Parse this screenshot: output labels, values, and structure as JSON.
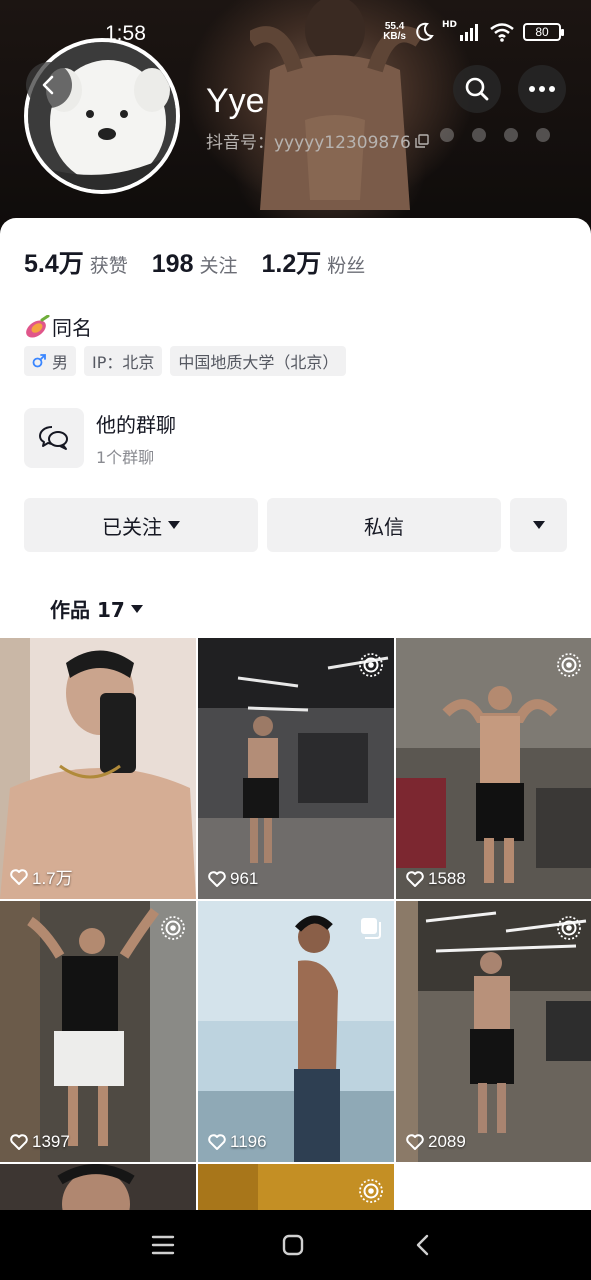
{
  "status_bar": {
    "time": "1:58",
    "net_speed_value": "55.4",
    "net_speed_unit": "KB/s",
    "hd_label": "HD",
    "battery": "80"
  },
  "profile": {
    "nickname": "Yye",
    "douyin_id": "抖音号：yyyyy12309876",
    "icons": [
      "back-icon",
      "search-icon",
      "more-icon",
      "copy-icon"
    ]
  },
  "stats": [
    {
      "value": "5.4万",
      "label": "获赞"
    },
    {
      "value": "198",
      "label": "关注"
    },
    {
      "value": "1.2万",
      "label": "粉丝"
    }
  ],
  "bio": "同名",
  "tags": {
    "gender": "男",
    "ip": "IP：北京",
    "school": "中国地质大学（北京）"
  },
  "group_chat": {
    "title": "他的群聊",
    "subtitle": "1个群聊"
  },
  "buttons": {
    "followed": "已关注",
    "message": "私信"
  },
  "works_tab": {
    "label": "作品 17"
  },
  "videos": [
    {
      "likes": "1.7万",
      "badge": ""
    },
    {
      "likes": "961",
      "badge": "live-photo-icon"
    },
    {
      "likes": "1588",
      "badge": "live-photo-icon"
    },
    {
      "likes": "1397",
      "badge": "live-photo-icon"
    },
    {
      "likes": "1196",
      "badge": "image-set-icon"
    },
    {
      "likes": "2089",
      "badge": "live-photo-icon"
    },
    {
      "likes": "",
      "badge": ""
    },
    {
      "likes": "",
      "badge": "live-photo-icon"
    }
  ],
  "colors": {
    "text_primary": "#161823",
    "text_secondary": "#6b6d75",
    "button_bg": "#f1f1f2",
    "gender_male": "#3a86ff"
  }
}
